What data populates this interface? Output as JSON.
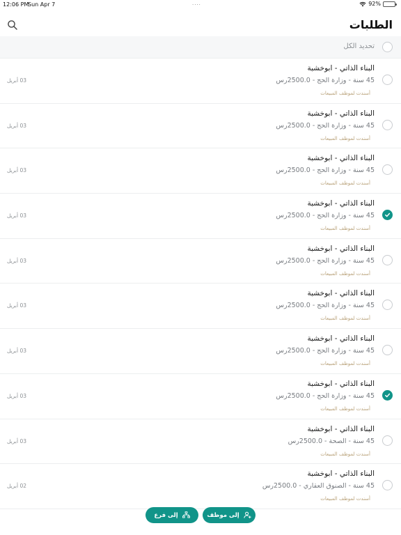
{
  "status_bar": {
    "time": "12:06 PM",
    "date": "Sun Apr 7",
    "dots": "....",
    "battery_text": "92%",
    "battery_level": 0.92
  },
  "header": {
    "title": "الطلبات",
    "search_icon": "search-icon"
  },
  "select_all": {
    "label": "تحديد الكل",
    "checked": false
  },
  "requests": [
    {
      "title": "البناء الذاتي - ابوخشبة",
      "subtitle": "45 سنة - وزارة الحج - 2500.0رس",
      "tag": "أسندت لموظف المبيعات",
      "date": "03 أبريل",
      "checked": false
    },
    {
      "title": "البناء الذاتي - ابوخشبة",
      "subtitle": "45 سنة - وزارة الحج - 2500.0رس",
      "tag": "أسندت لموظف المبيعات",
      "date": "03 أبريل",
      "checked": false
    },
    {
      "title": "البناء الذاتي - ابوخشبة",
      "subtitle": "45 سنة - وزارة الحج - 2500.0رس",
      "tag": "أسندت لموظف المبيعات",
      "date": "03 أبريل",
      "checked": false
    },
    {
      "title": "البناء الذاتي - ابوخشبة",
      "subtitle": "45 سنة - وزارة الحج - 2500.0رس",
      "tag": "أسندت لموظف المبيعات",
      "date": "03 أبريل",
      "checked": true
    },
    {
      "title": "البناء الذاتي - ابوخشبة",
      "subtitle": "45 سنة - وزارة الحج - 2500.0رس",
      "tag": "أسندت لموظف المبيعات",
      "date": "03 أبريل",
      "checked": false
    },
    {
      "title": "البناء الذاتي - ابوخشبة",
      "subtitle": "45 سنة - وزارة الحج - 2500.0رس",
      "tag": "أسندت لموظف المبيعات",
      "date": "03 أبريل",
      "checked": false
    },
    {
      "title": "البناء الذاتي - ابوخشبة",
      "subtitle": "45 سنة - وزارة الحج - 2500.0رس",
      "tag": "أسندت لموظف المبيعات",
      "date": "03 أبريل",
      "checked": false
    },
    {
      "title": "البناء الذاتي - ابوخشبة",
      "subtitle": "45 سنة - وزارة الحج - 2500.0رس",
      "tag": "أسندت لموظف المبيعات",
      "date": "03 أبريل",
      "checked": true
    },
    {
      "title": "البناء الذاتي - ابوخشبة",
      "subtitle": "45 سنة - الصحة - 2500.0رس",
      "tag": "أسندت لموظف المبيعات",
      "date": "03 أبريل",
      "checked": false
    },
    {
      "title": "البناء الذاتي - ابوخشبة",
      "subtitle": "45 سنة - الصنوق العقاري - 2500.0رس",
      "tag": "أسندت لموظف المبيعات",
      "date": "02 أبريل",
      "checked": false
    }
  ],
  "actions": {
    "to_employee": "إلى موظف",
    "to_branch": "إلى فرع"
  },
  "colors": {
    "accent": "#119489",
    "tag": "#b9a27a",
    "muted": "#8b8f93"
  }
}
